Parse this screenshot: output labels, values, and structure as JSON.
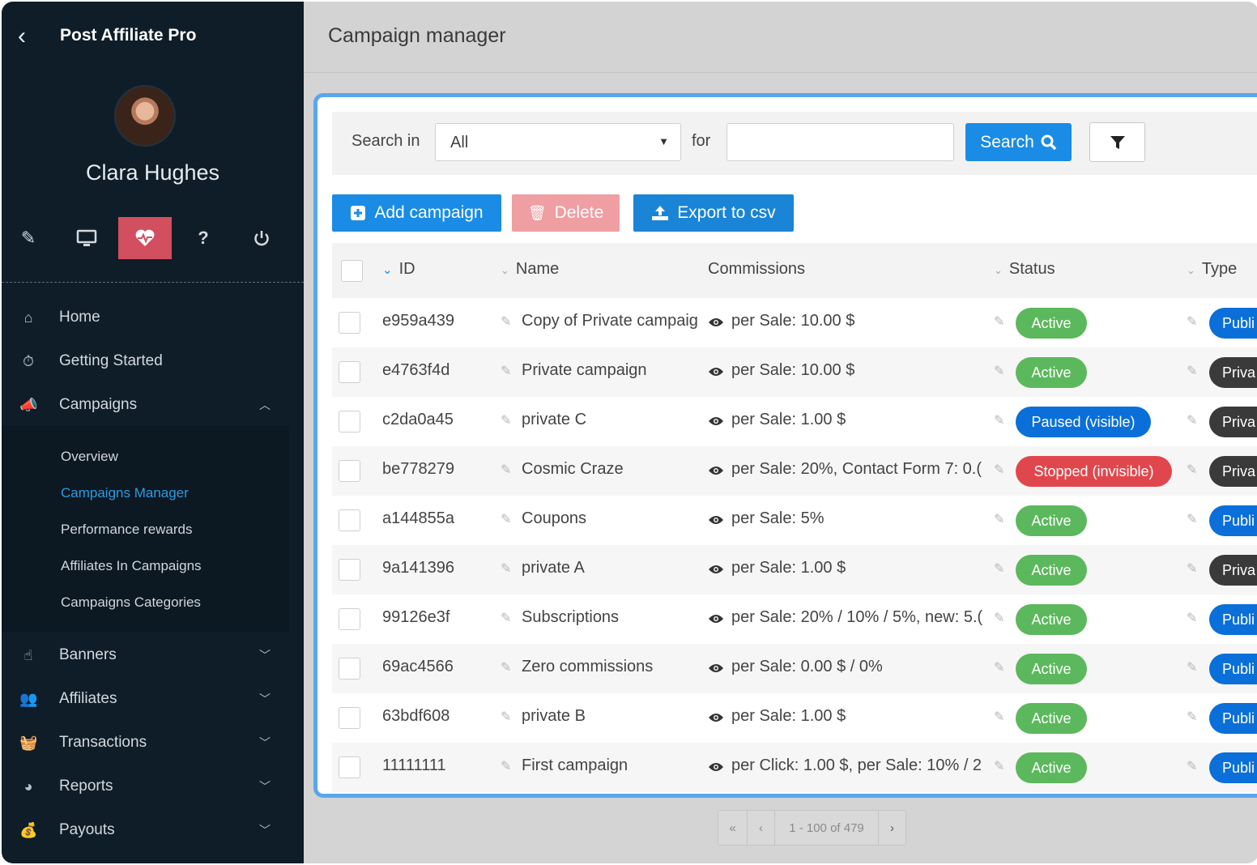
{
  "app": {
    "brand": "Post Affiliate Pro",
    "back_icon": "chevron-left-icon"
  },
  "user": {
    "name": "Clara Hughes"
  },
  "tools": [
    {
      "icon": "pencil-icon",
      "glyph": "✎"
    },
    {
      "icon": "monitor-icon",
      "glyph": "🖵"
    },
    {
      "icon": "heart-pulse-icon",
      "glyph": "♥"
    },
    {
      "icon": "help-icon",
      "glyph": "?"
    },
    {
      "icon": "power-icon",
      "glyph": "⏻"
    }
  ],
  "nav": {
    "home": "Home",
    "getting_started": "Getting Started",
    "campaigns": "Campaigns",
    "campaigns_sub": [
      "Overview",
      "Campaigns Manager",
      "Performance rewards",
      "Affiliates In Campaigns",
      "Campaigns Categories"
    ],
    "banners": "Banners",
    "affiliates": "Affiliates",
    "transactions": "Transactions",
    "reports": "Reports",
    "payouts": "Payouts"
  },
  "page": {
    "title": "Campaign manager"
  },
  "search": {
    "search_in_label": "Search in",
    "select_value": "All",
    "for_label": "for",
    "query": "",
    "search_button": "Search"
  },
  "actions": {
    "add": "Add campaign",
    "delete": "Delete",
    "export": "Export to csv"
  },
  "table": {
    "headers": {
      "id": "ID",
      "name": "Name",
      "commissions": "Commissions",
      "status": "Status",
      "type": "Type"
    },
    "rows": [
      {
        "id": "e959a439",
        "name": "Copy of Private campaig",
        "commissions": "per Sale: 10.00 $",
        "status": "Active",
        "type": "Publi"
      },
      {
        "id": "e4763f4d",
        "name": "Private campaign",
        "commissions": "per Sale: 10.00 $",
        "status": "Active",
        "type": "Priva"
      },
      {
        "id": "c2da0a45",
        "name": "private C",
        "commissions": "per Sale: 1.00 $",
        "status": "Paused (visible)",
        "type": "Priva"
      },
      {
        "id": "be778279",
        "name": "Cosmic Craze",
        "commissions": "per Sale: 20%, Contact Form 7: 0.(",
        "status": "Stopped (invisible)",
        "type": "Priva"
      },
      {
        "id": "a144855a",
        "name": "Coupons",
        "commissions": "per Sale: 5%",
        "status": "Active",
        "type": "Publi"
      },
      {
        "id": "9a141396",
        "name": "private A",
        "commissions": "per Sale: 1.00 $",
        "status": "Active",
        "type": "Priva"
      },
      {
        "id": "99126e3f",
        "name": "Subscriptions",
        "commissions": "per Sale: 20% / 10% / 5%, new: 5.(",
        "status": "Active",
        "type": "Publi"
      },
      {
        "id": "69ac4566",
        "name": "Zero commissions",
        "commissions": "per Sale: 0.00 $ / 0%",
        "status": "Active",
        "type": "Publi"
      },
      {
        "id": "63bdf608",
        "name": "private B",
        "commissions": "per Sale: 1.00 $",
        "status": "Active",
        "type": "Publi"
      },
      {
        "id": "11111111",
        "name": "First campaign",
        "commissions": "per Click: 1.00 $, per Sale: 10% / 2",
        "status": "Active",
        "type": "Publi"
      }
    ]
  },
  "pager": {
    "first": "«",
    "prev": "‹",
    "range": "1 - 100 of 479",
    "next": "›"
  },
  "colors": {
    "sidebar_bg": "#0f1d28",
    "accent_blue": "#1a8ce6",
    "active_green": "#5cb85c",
    "paused_blue": "#0a6fd8",
    "stopped_red": "#e0474c",
    "private_dark": "#3a3a3a",
    "delete_pink": "#ef9ea2",
    "active_tool_red": "#d24f5f"
  }
}
